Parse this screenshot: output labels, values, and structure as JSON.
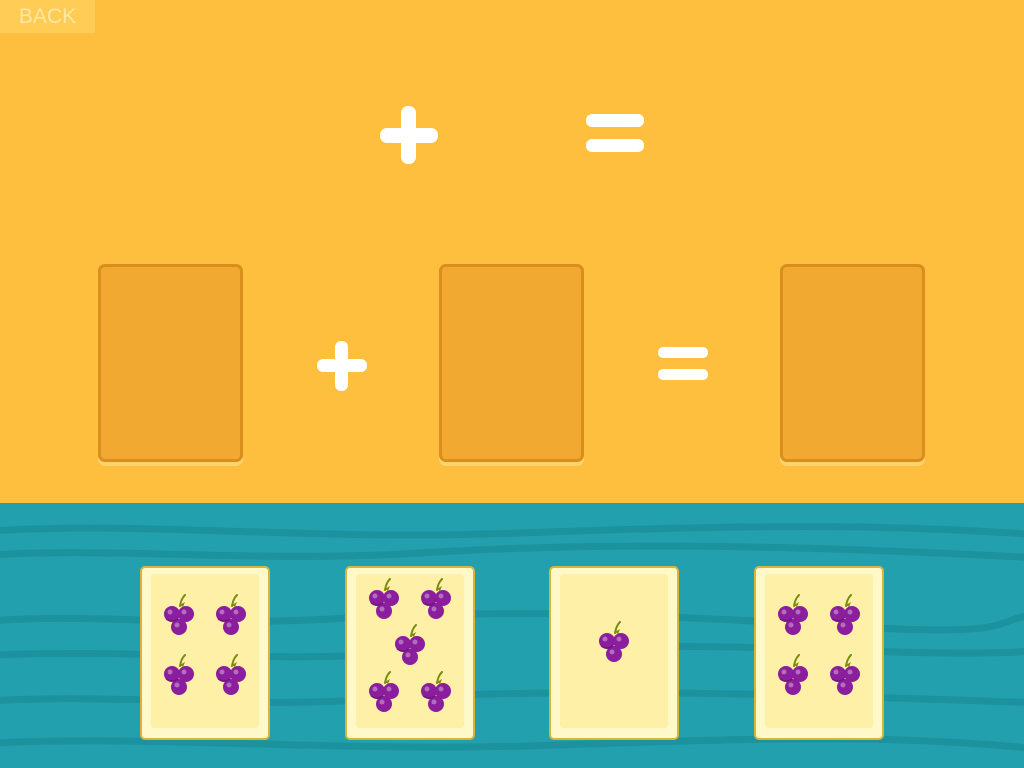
{
  "colors": {
    "top_background": "#FDBF3D",
    "table_background": "#23A0AE",
    "table_wave": "#1A8C99",
    "operator": "#FFFFFF",
    "slot_fill": "#F2A931",
    "slot_border": "#D98E1E",
    "slot_shadow": "#FFD36B",
    "card_outer": "#FFF9C9",
    "card_border": "#D8B43A",
    "card_inner": "#FFF0A8",
    "grape_fill": "#8A1E9C",
    "grape_shade": "#5E0F75",
    "grape_stem": "#7A8C10",
    "back_button_bg": "#FFCC55",
    "back_button_text": "#FFE7A0"
  },
  "back_button": {
    "label": "BACK"
  },
  "equation_top": {
    "operator_1": "plus-icon",
    "operator_2": "equals-icon"
  },
  "equation_slots": {
    "operator_1": "plus-icon",
    "operator_2": "equals-icon",
    "slots": [
      "empty",
      "empty",
      "empty"
    ]
  },
  "cards": [
    {
      "count": 4,
      "icon": "grape-bunch-icon"
    },
    {
      "count": 5,
      "icon": "grape-bunch-icon"
    },
    {
      "count": 1,
      "icon": "grape-bunch-icon"
    },
    {
      "count": 4,
      "icon": "grape-bunch-icon"
    }
  ]
}
